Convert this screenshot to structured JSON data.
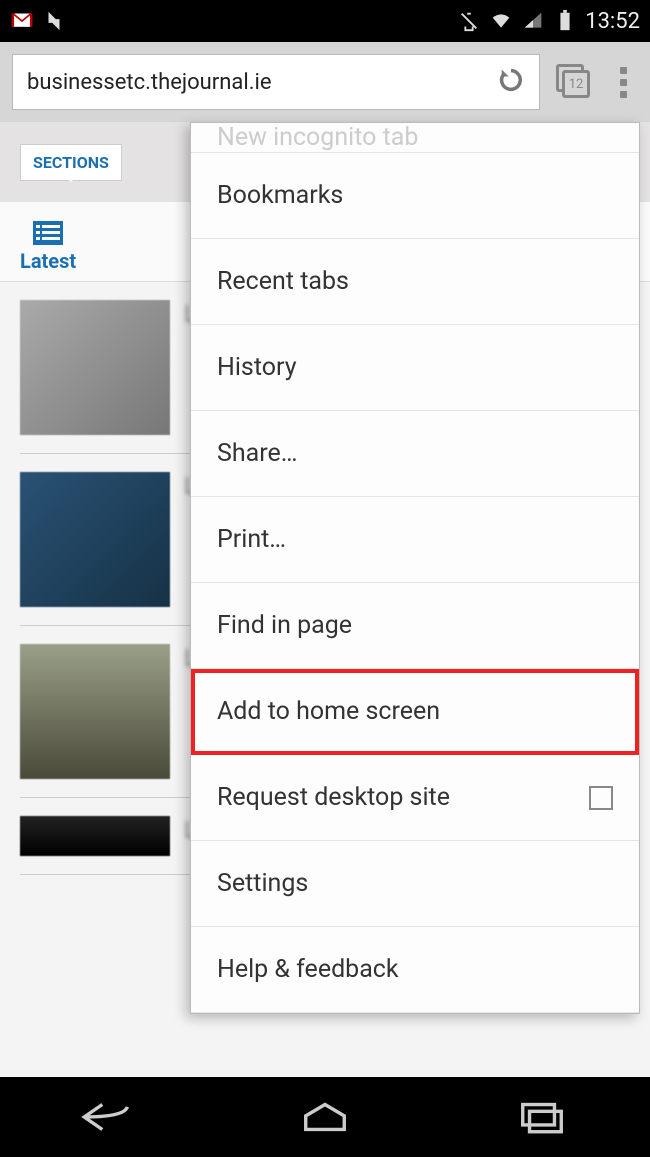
{
  "status": {
    "time": "13:52"
  },
  "browser": {
    "url": "businessetc.thejournal.ie",
    "tab_count": "12"
  },
  "page": {
    "sections_label": "SECTIONS",
    "tab_latest": "Latest"
  },
  "menu": {
    "faded_top": "New incognito tab",
    "items": [
      "Bookmarks",
      "Recent tabs",
      "History",
      "Share…",
      "Print…",
      "Find in page",
      "Add to home screen",
      "Request desktop site",
      "Settings",
      "Help & feedback"
    ],
    "highlighted_index": 6,
    "checkbox_index": 7
  }
}
